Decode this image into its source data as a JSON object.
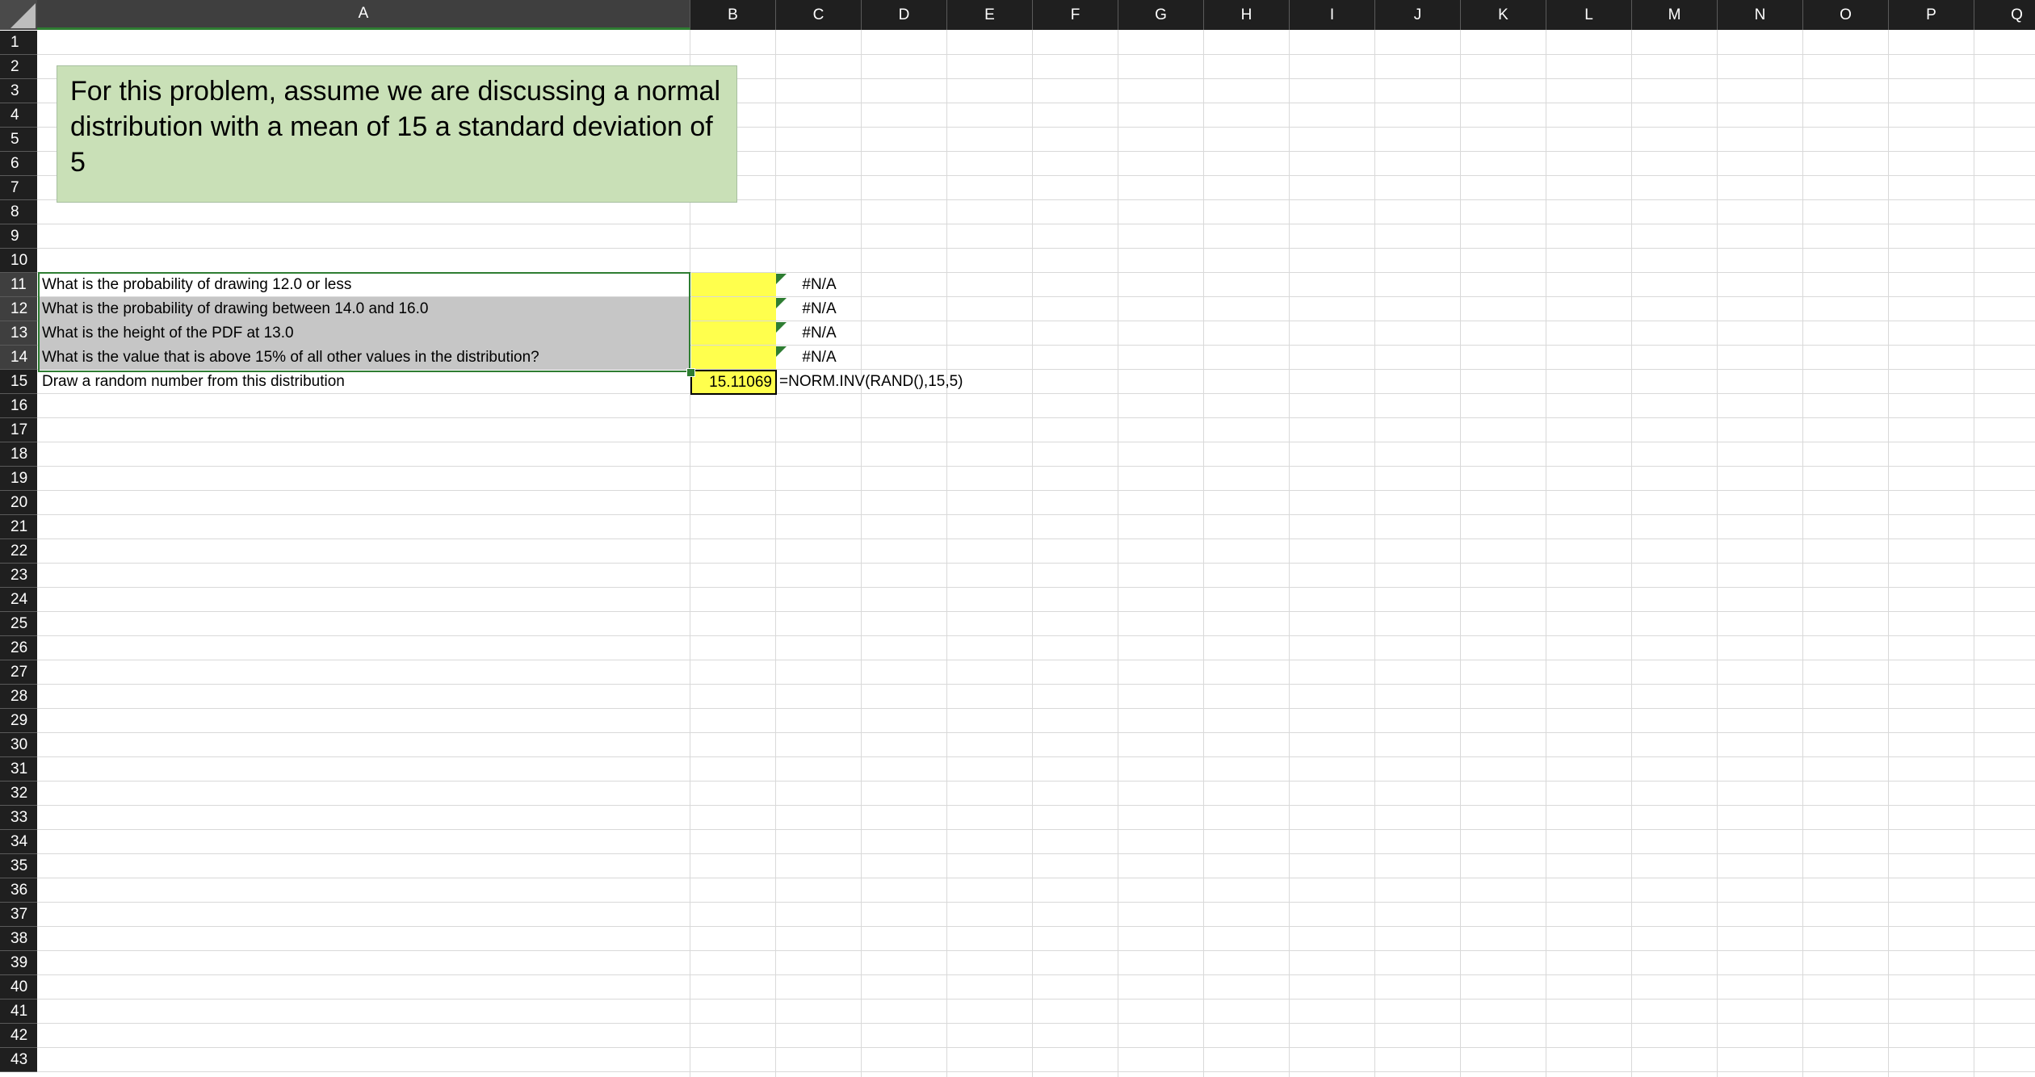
{
  "columns": [
    "A",
    "B",
    "C",
    "D",
    "E",
    "F",
    "G",
    "H",
    "I",
    "J",
    "K",
    "L",
    "M",
    "N",
    "O",
    "P",
    "Q"
  ],
  "rows": [
    "1",
    "2",
    "3",
    "4",
    "5",
    "6",
    "7",
    "8",
    "9",
    "10",
    "11",
    "12",
    "13",
    "14",
    "15",
    "16",
    "17",
    "18",
    "19",
    "20",
    "21",
    "22",
    "23",
    "24",
    "25",
    "26",
    "27",
    "28",
    "29",
    "30",
    "31",
    "32",
    "33",
    "34",
    "35",
    "36",
    "37",
    "38",
    "39",
    "40",
    "41",
    "42",
    "43"
  ],
  "note": "For this problem, assume we are discussing a normal distribution with a mean of 15 a standard deviation of 5",
  "questions": [
    {
      "label": "What is the probability of drawing 12.0 or less",
      "answer": "",
      "check": "#N/A"
    },
    {
      "label": "What is the probability of drawing between 14.0 and 16.0",
      "answer": "",
      "check": "#N/A"
    },
    {
      "label": "What is the height of the PDF at 13.0",
      "answer": "",
      "check": "#N/A"
    },
    {
      "label": "What is the value that is above 15% of all other values in the distribution?",
      "answer": "",
      "check": "#N/A"
    }
  ],
  "random_row": {
    "label": "Draw a random number from this distribution",
    "value": "15.11069",
    "formula": "=NORM.INV(RAND(),15,5)"
  },
  "colors": {
    "header": "#1f1f1f",
    "answer_fill": "#ffff4d",
    "note_fill": "#c9e0b7",
    "selection": "#2e7d32",
    "shaded_row": "#c6c6c6"
  }
}
